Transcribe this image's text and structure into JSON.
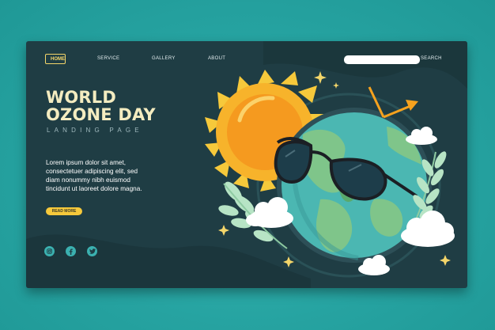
{
  "nav": {
    "home": "HOME",
    "service": "SERVICE",
    "gallery": "GALLERY",
    "about": "ABOUT",
    "search_label": "SEARCH"
  },
  "hero": {
    "title_line1": "WORLD",
    "title_line2": "OZONE DAY",
    "subtitle": "LANDING PAGE",
    "description": [
      "Lorem ipsum dolor sit amet,",
      "consectetuer adipiscing elit, sed",
      "diam nonummy nibh euismod",
      "tincidunt ut laoreet dolore magna."
    ],
    "cta": "READ MORE"
  },
  "social": [
    "instagram-icon",
    "facebook-icon",
    "twitter-icon"
  ],
  "colors": {
    "background": "#27a8a6",
    "card": "#1f3d44",
    "accent_yellow": "#f6c93b",
    "sun": "#f7b32b",
    "earth_ocean": "#4bb7b2",
    "earth_land": "#7fc58a"
  }
}
